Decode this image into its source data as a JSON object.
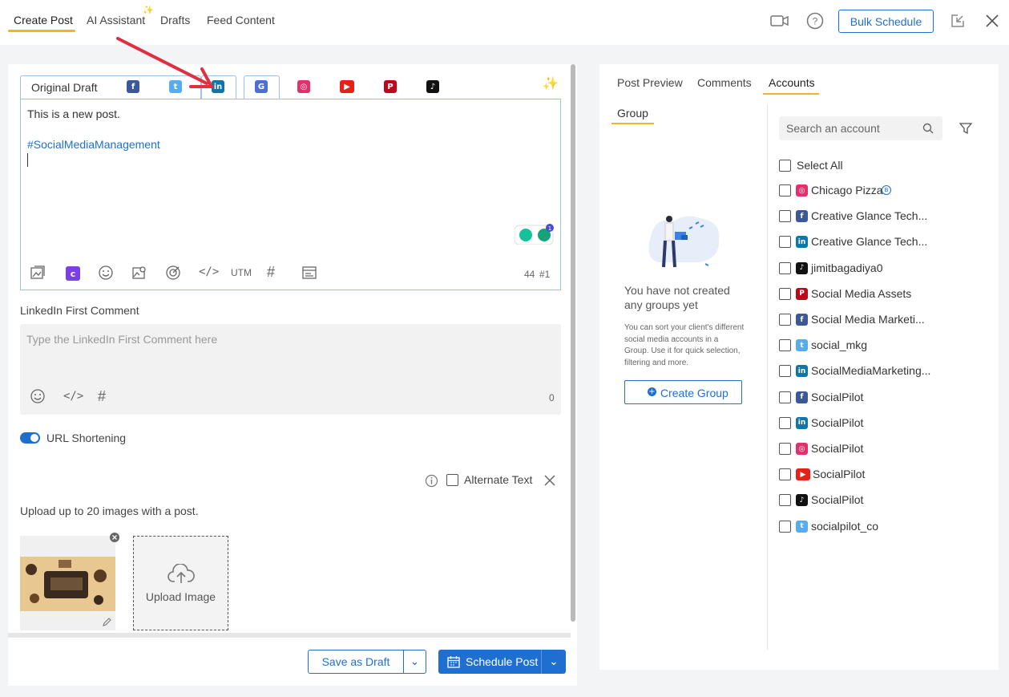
{
  "top_tabs": {
    "create_post": "Create Post",
    "ai_assistant": "AI Assistant",
    "drafts": "Drafts",
    "feed_content": "Feed Content"
  },
  "top_actions": {
    "bulk_schedule": "Bulk Schedule"
  },
  "network_tabs": {
    "original": "Original Draft",
    "networks": [
      "facebook-icon",
      "twitter-icon",
      "linkedin-icon",
      "google-business-icon",
      "instagram-icon",
      "youtube-icon",
      "pinterest-icon",
      "tiktok-icon"
    ]
  },
  "editor": {
    "text": "This is a new post.",
    "hashtag": "#SocialMediaManagement",
    "char_count": "44",
    "hashtag_count": "#1",
    "utm": "UTM"
  },
  "first_comment": {
    "label": "LinkedIn First Comment",
    "placeholder": "Type the LinkedIn First Comment here",
    "count": "0"
  },
  "url_shortening": {
    "label": "URL Shortening",
    "enabled": true
  },
  "alt_text": {
    "label": "Alternate Text"
  },
  "media": {
    "hint": "Upload up to 20 images with a post.",
    "upload_label": "Upload Image"
  },
  "footer": {
    "save_draft": "Save as Draft",
    "schedule": "Schedule Post"
  },
  "right_tabs": {
    "preview": "Post Preview",
    "comments": "Comments",
    "accounts": "Accounts"
  },
  "groups": {
    "tab": "Group",
    "empty_title": "You have not created any groups yet",
    "empty_desc": "You can sort your client's different social media accounts in a Group. Use it for quick selection, filtering and more.",
    "create": "Create Group"
  },
  "accounts": {
    "search_placeholder": "Search an account",
    "select_all": "Select All",
    "items": [
      {
        "name": "Chicago Pizza",
        "network": "instagram"
      },
      {
        "name": "Creative Glance Tech...",
        "network": "facebook"
      },
      {
        "name": "Creative Glance Tech...",
        "network": "linkedin"
      },
      {
        "name": "jimitbagadiya0",
        "network": "tiktok"
      },
      {
        "name": "Social Media Assets",
        "network": "pinterest"
      },
      {
        "name": "Social Media Marketi...",
        "network": "facebook"
      },
      {
        "name": "social_mkg",
        "network": "twitter"
      },
      {
        "name": "SocialMediaMarketing...",
        "network": "linkedin"
      },
      {
        "name": "SocialPilot",
        "network": "facebook"
      },
      {
        "name": "SocialPilot",
        "network": "linkedin"
      },
      {
        "name": "SocialPilot",
        "network": "instagram"
      },
      {
        "name": "SocialPilot",
        "network": "youtube"
      },
      {
        "name": "SocialPilot",
        "network": "tiktok"
      },
      {
        "name": "socialpilot_co",
        "network": "twitter"
      }
    ]
  },
  "colors": {
    "primary": "#1f6fd1",
    "accent": "#f0b429",
    "facebook": "#3b5998",
    "twitter": "#55acee",
    "linkedin": "#0e76a8",
    "instagram": "#e1306c",
    "youtube": "#e62117",
    "pinterest": "#bd081c",
    "tiktok": "#111111"
  }
}
